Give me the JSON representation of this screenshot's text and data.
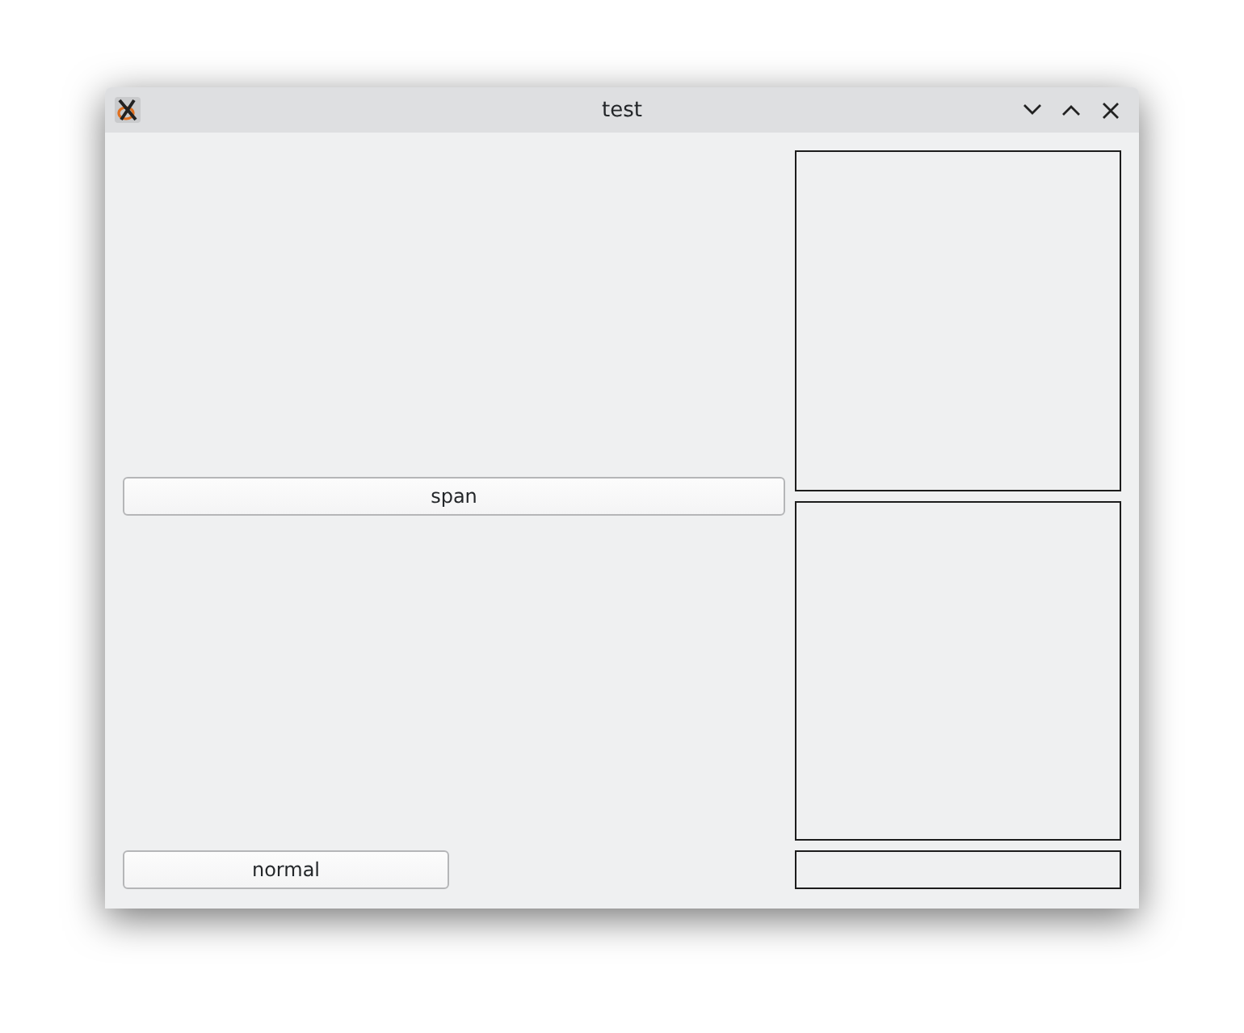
{
  "window": {
    "title": "test"
  },
  "buttons": [
    {
      "label": "span",
      "kind": "span"
    },
    {
      "label": "normal",
      "kind": "normal"
    }
  ]
}
